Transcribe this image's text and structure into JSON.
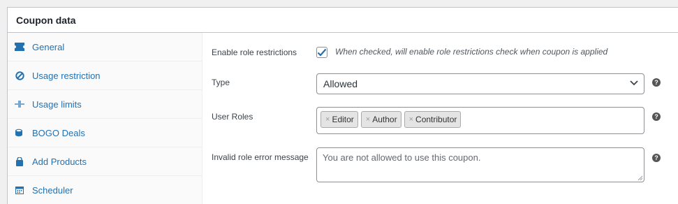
{
  "panel": {
    "title": "Coupon data"
  },
  "sidebar": {
    "items": [
      {
        "label": "General",
        "icon": "ticket-icon"
      },
      {
        "label": "Usage restriction",
        "icon": "ban-icon"
      },
      {
        "label": "Usage limits",
        "icon": "limits-icon"
      },
      {
        "label": "BOGO Deals",
        "icon": "coins-icon"
      },
      {
        "label": "Add Products",
        "icon": "bag-icon"
      },
      {
        "label": "Scheduler",
        "icon": "calendar-icon"
      }
    ]
  },
  "form": {
    "enable_roles": {
      "label": "Enable role restrictions",
      "checked": true,
      "description": "When checked, will enable role restrictions check when coupon is applied"
    },
    "type": {
      "label": "Type",
      "value": "Allowed"
    },
    "user_roles": {
      "label": "User Roles",
      "tags": [
        "Editor",
        "Author",
        "Contributor"
      ]
    },
    "error_message": {
      "label": "Invalid role error message",
      "placeholder": "You are not allowed to use this coupon."
    },
    "help_glyph": "?",
    "tag_remove_glyph": "×"
  },
  "colors": {
    "link": "#2271b1",
    "border": "#8c8f94",
    "check": "#2271b1"
  }
}
